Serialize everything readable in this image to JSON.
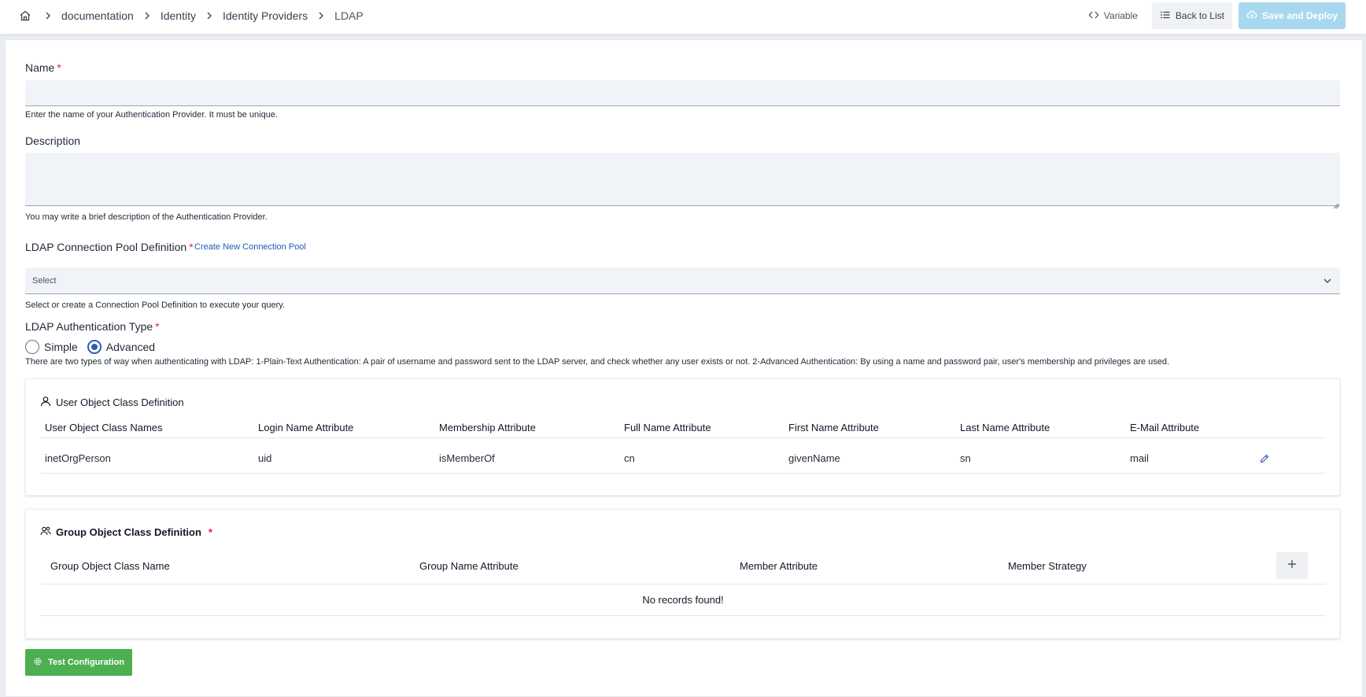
{
  "breadcrumb": {
    "home_icon": "home-icon",
    "items": [
      "documentation",
      "Identity",
      "Identity Providers",
      "LDAP"
    ]
  },
  "toolbar": {
    "variable_label": "Variable",
    "back_label": "Back to List",
    "save_label": "Save and Deploy"
  },
  "form": {
    "name": {
      "label": "Name",
      "required_mark": "*",
      "value": "",
      "help": "Enter the name of your Authentication Provider. It must be unique."
    },
    "description": {
      "label": "Description",
      "value": "",
      "help": "You may write a brief description of the Authentication Provider."
    },
    "connection_pool": {
      "label": "LDAP Connection Pool Definition",
      "required_mark": "*",
      "create_link": "Create New Connection Pool",
      "selected": "Select",
      "help": "Select or create a Connection Pool Definition to execute your query."
    },
    "auth_type": {
      "label": "LDAP Authentication Type",
      "required_mark": "*",
      "options": [
        "Simple",
        "Advanced"
      ],
      "selected": "Advanced",
      "help": "There are two types of way when authenticating with LDAP: 1-Plain-Text Authentication: A pair of username and password sent to the LDAP server, and check whether any user exists or not. 2-Advanced Authentication: By using a name and password pair, user's membership and privileges are used."
    }
  },
  "user_object_class": {
    "title": "User Object Class Definition",
    "columns": [
      "User Object Class Names",
      "Login Name Attribute",
      "Membership Attribute",
      "Full Name Attribute",
      "First Name Attribute",
      "Last Name Attribute",
      "E-Mail Attribute"
    ],
    "rows": [
      [
        "inetOrgPerson",
        "uid",
        "isMemberOf",
        "cn",
        "givenName",
        "sn",
        "mail"
      ]
    ]
  },
  "group_object_class": {
    "title": "Group Object Class Definition",
    "required_mark": "*",
    "columns": [
      "Group Object Class Name",
      "Group Name Attribute",
      "Member Attribute",
      "Member Strategy"
    ],
    "empty_text": "No records found!"
  },
  "test_button": {
    "label": "Test Configuration"
  },
  "colors": {
    "accent": "#2e59b7",
    "save_disabled": "#a8d8f0",
    "test_button": "#4caf50",
    "required": "#e11d48"
  }
}
